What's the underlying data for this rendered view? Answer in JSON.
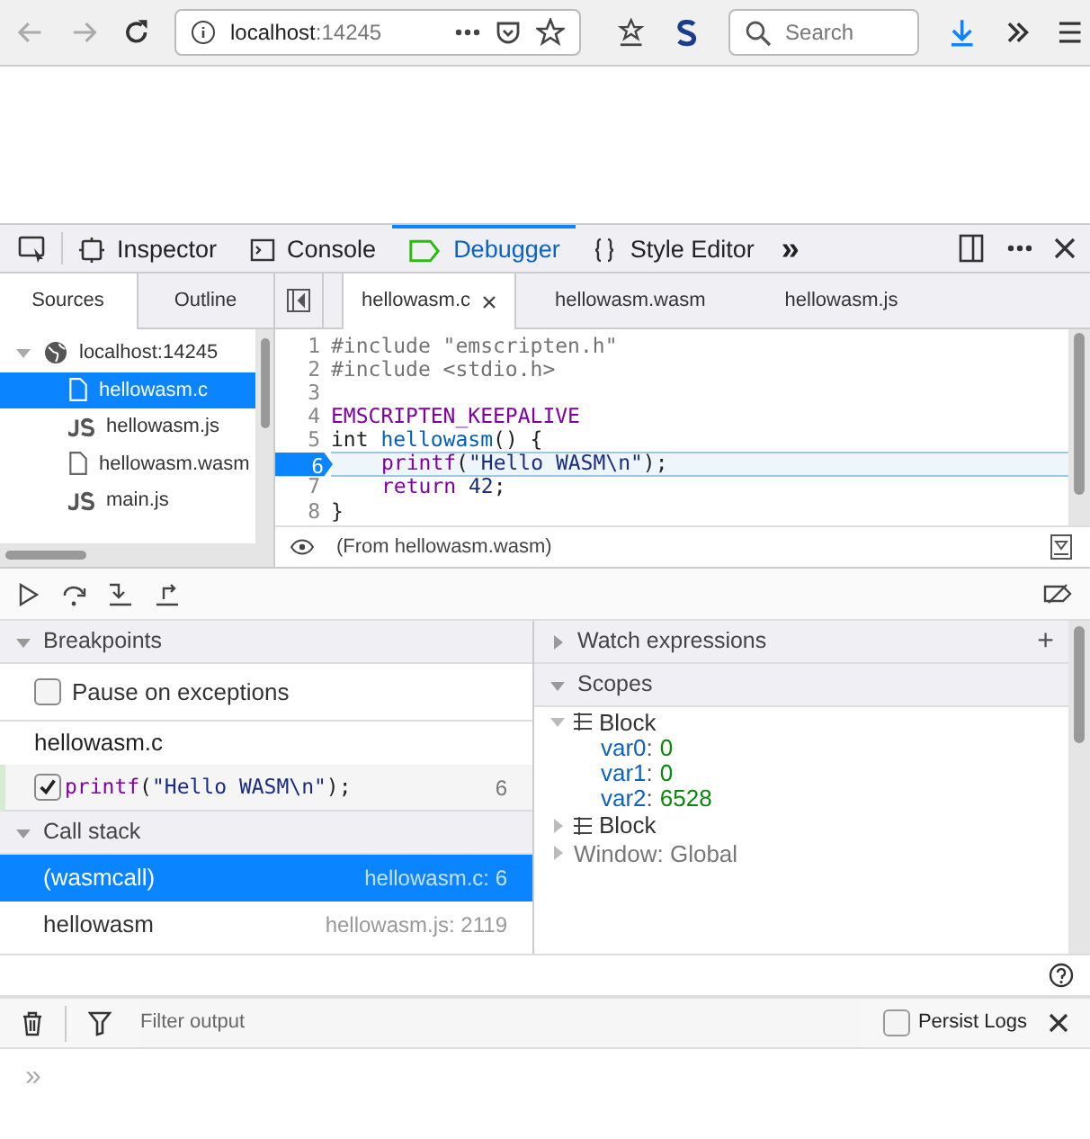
{
  "browser": {
    "url_host": "localhost",
    "url_port": ":14245",
    "search": {
      "placeholder": "Search"
    }
  },
  "devtools_tabs": [
    {
      "label": "Inspector",
      "selected": false
    },
    {
      "label": "Console",
      "selected": false
    },
    {
      "label": "Debugger",
      "selected": true
    },
    {
      "label": "Style Editor",
      "selected": false
    }
  ],
  "overflow_button": "»",
  "source_tabs": [
    {
      "label": "Sources",
      "selected": true
    },
    {
      "label": "Outline",
      "selected": false
    }
  ],
  "source_tree": [
    {
      "label": "localhost:14245",
      "kind": "host",
      "expanded": true,
      "selected": false,
      "children": [
        {
          "label": "hellowasm.c",
          "kind": "file",
          "selected": true
        },
        {
          "label": "hellowasm.js",
          "kind": "js",
          "selected": false
        },
        {
          "label": "hellowasm.wasm",
          "kind": "file",
          "selected": false
        },
        {
          "label": "main.js",
          "kind": "js",
          "selected": false
        }
      ]
    }
  ],
  "editor_tabs": [
    {
      "label": "hellowasm.c",
      "selected": true,
      "closable": true
    },
    {
      "label": "hellowasm.wasm",
      "selected": false,
      "closable": false
    },
    {
      "label": "hellowasm.js",
      "selected": false,
      "closable": false
    }
  ],
  "code_lines": [
    {
      "number": "1",
      "paused": false,
      "tokens": [
        {
          "kind": "preproc",
          "text": "#include \"emscripten.h\""
        }
      ]
    },
    {
      "number": "2",
      "paused": false,
      "tokens": [
        {
          "kind": "preproc",
          "text": "#include <stdio.h>"
        }
      ]
    },
    {
      "number": "3",
      "paused": false
    },
    {
      "number": "4",
      "paused": false,
      "tokens": [
        {
          "kind": "keyword",
          "text": "EMSCRIPTEN_KEEPALIVE"
        }
      ]
    },
    {
      "number": "5",
      "paused": false,
      "tokens": [
        {
          "kind": "plain",
          "text": "int "
        },
        {
          "kind": "function",
          "text": "hellowasm"
        },
        {
          "kind": "plain",
          "text": "() {"
        }
      ]
    },
    {
      "number": "6",
      "paused": true,
      "indented": true,
      "tokens": [
        {
          "kind": "keyword",
          "text": "printf"
        },
        {
          "kind": "plain",
          "text": "("
        },
        {
          "kind": "literal",
          "text": "\"Hello WASM\\n\""
        },
        {
          "kind": "plain",
          "text": ");"
        }
      ]
    },
    {
      "number": "7",
      "paused": false,
      "indented": true,
      "tokens": [
        {
          "kind": "keyword",
          "text": "return "
        },
        {
          "kind": "literal",
          "text": "42"
        },
        {
          "kind": "plain",
          "text": ";"
        }
      ]
    },
    {
      "number": "8",
      "paused": false,
      "tokens": [
        {
          "kind": "plain",
          "text": "}"
        }
      ]
    }
  ],
  "editor_footer": "(From hellowasm.wasm)",
  "breakpoints": {
    "title": "Breakpoints",
    "expanded": true,
    "pause_on_exceptions": {
      "label": "Pause on exceptions",
      "checked": false
    },
    "files": [
      {
        "name": "hellowasm.c",
        "items": [
          {
            "checked": true,
            "line": "6",
            "tokens": [
              {
                "kind": "keyword",
                "text": "printf"
              },
              {
                "kind": "plain",
                "text": "("
              },
              {
                "kind": "literal",
                "text": "\"Hello WASM\\n\""
              },
              {
                "kind": "plain",
                "text": ");"
              }
            ]
          }
        ]
      }
    ]
  },
  "call_stack": {
    "title": "Call stack",
    "expanded": true,
    "frames": [
      {
        "name": "(wasmcall)",
        "location": "hellowasm.c: 6",
        "selected": true
      },
      {
        "name": "hellowasm",
        "location": "hellowasm.js: 2119",
        "selected": false
      }
    ]
  },
  "watch": {
    "title": "Watch expressions",
    "expanded": false,
    "add": "+"
  },
  "scopes": {
    "title": "Scopes",
    "expanded": true,
    "items": [
      {
        "label": "Block",
        "kind": "block",
        "expanded": true,
        "vars": [
          {
            "name": "var0",
            "separator": ":",
            "value": "0"
          },
          {
            "name": "var1",
            "separator": ":",
            "value": "0"
          },
          {
            "name": "var2",
            "separator": ":",
            "value": "6528"
          }
        ]
      },
      {
        "label": "Block",
        "kind": "block",
        "expanded": false
      },
      {
        "label": "Window: Global",
        "kind": "global",
        "expanded": false
      }
    ]
  },
  "console": {
    "filter": {
      "placeholder": "Filter output"
    },
    "persist_logs": {
      "label": "Persist Logs",
      "checked": false
    },
    "prompt": "»"
  }
}
